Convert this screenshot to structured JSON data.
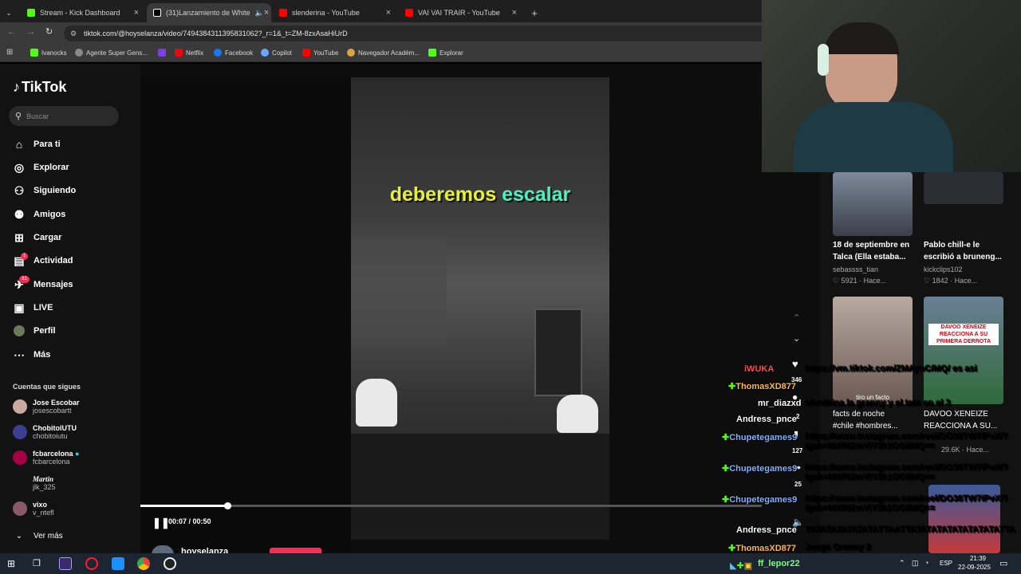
{
  "browser": {
    "tabs": [
      {
        "title": "Stream - Kick Dashboard",
        "color": "#53fc18"
      },
      {
        "title": "(31)Lanzamiento de White",
        "color": "#ffffff"
      },
      {
        "title": "slenderina - YouTube",
        "color": "#ff0000"
      },
      {
        "title": "VAI VAI TRAIR - YouTube",
        "color": "#ff0000"
      }
    ],
    "new_tab": "+",
    "url": "tiktok.com/@hoyselanza/video/7494384311395831062?_r=1&_t=ZM-8zxAsaHiUrD",
    "bookmarks": [
      "Ivanocks",
      "Agente Super Gens...",
      "Netflix",
      "Facebook",
      "Copilot",
      "YouTube",
      "Navegador Académ...",
      "Explorar"
    ]
  },
  "tiktok": {
    "logo": "TikTok",
    "search_placeholder": "Buscar",
    "nav": [
      {
        "label": "Para ti",
        "icon": "home-icon"
      },
      {
        "label": "Explorar",
        "icon": "compass-icon"
      },
      {
        "label": "Siguiendo",
        "icon": "following-icon"
      },
      {
        "label": "Amigos",
        "icon": "friends-icon"
      },
      {
        "label": "Cargar",
        "icon": "upload-icon"
      },
      {
        "label": "Actividad",
        "icon": "activity-icon",
        "badge": "1"
      },
      {
        "label": "Mensajes",
        "icon": "messages-icon",
        "badge": "31"
      },
      {
        "label": "LIVE",
        "icon": "live-icon"
      },
      {
        "label": "Perfil",
        "icon": "profile-icon"
      },
      {
        "label": "Más",
        "icon": "more-icon"
      }
    ],
    "following_header": "Cuentas que sigues",
    "following": [
      {
        "name": "Jose Escobar",
        "handle": "josescobartt"
      },
      {
        "name": "ChobitolUTU",
        "handle": "chobitoiutu"
      },
      {
        "name": "fcbarcelona",
        "handle": "fcbarcelona"
      },
      {
        "name": "Martin",
        "handle": "jlk_325"
      },
      {
        "name": "vixo",
        "handle": "v_ntefl"
      }
    ],
    "see_more": "Ver más"
  },
  "video": {
    "caption_a": "deberemos",
    "caption_b": "escalar",
    "time": "00:07 / 00:50",
    "progress": 0.14,
    "author": "hoyselanza",
    "side_counts": [
      "346",
      "2",
      "127",
      "25"
    ]
  },
  "recommended": [
    {
      "title_1": "18 de septiembre en",
      "title_2": "Talca (Ella estaba...",
      "user": "sebassss_tian",
      "stats": "5921 · Hace..."
    },
    {
      "title_1": "Pablo chill-e le",
      "title_2": "escribió a bruneng...",
      "user": "kickclips102",
      "stats": "1842 · Hace..."
    },
    {
      "title_1": "facts de noche",
      "title_2": "#chile #hombres...",
      "overlay": "tiro un facto",
      "user": "",
      "stats": ""
    },
    {
      "title_1": "DAVOO XENEIZE",
      "title_2": "REACCIONA A SU...",
      "overlay": "DAVOO XENEIZE REACCIONA A SU PRIMERA DERROTA",
      "user": "",
      "stats": "29.6K · Hace..."
    }
  ],
  "chat": [
    {
      "user": "iWUKA",
      "msg": "https://vm.tiktok.com/ZMAynC/MQ/ es asi",
      "color": "#ff4d4d"
    },
    {
      "user": "ThomasXD877",
      "msg": "",
      "color": "#ffb84d"
    },
    {
      "user": "mr_diazxd",
      "msg": "slendrina la granny y el tata en el 3",
      "color": "#ffffff"
    },
    {
      "user": "Andress_pnce",
      "msg": "",
      "color": "#ffffff"
    },
    {
      "user": "Chupetegames9",
      "msg": "https://www.instagram.com/reel/DO38TW7iPvX/?",
      "msg2": "igsh=MXRlZmViY2k1OGliMQ==",
      "color": "#7fb2ff"
    },
    {
      "user": "Chupetegames9",
      "msg": "https://www.instagram.com/reel/DO38TW7iPvX/?",
      "msg2": "igsh=MXRlZmViY2k1OGliMQ==",
      "color": "#7fb2ff"
    },
    {
      "user": "Chupetegames9",
      "msg": "https://www.instagram.com/reel/DO38TW7iPvX/?",
      "msg2": "igsh=MXRlZmViY2k1OGliMQ==",
      "color": "#7fb2ff"
    },
    {
      "user": "Andress_pnce",
      "msg": "TATATATATATATATTAATTATATATATATATATATATTA",
      "color": "#ffffff"
    },
    {
      "user": "ThomasXD877",
      "msg": "Juega Granny 2",
      "color": "#ffb84d"
    },
    {
      "user": "ff_lepor22",
      "msg": "",
      "color": "#7cff7c"
    }
  ],
  "taskbar": {
    "lang": "ESP",
    "time": "21:39",
    "date": "22-09-2025"
  }
}
